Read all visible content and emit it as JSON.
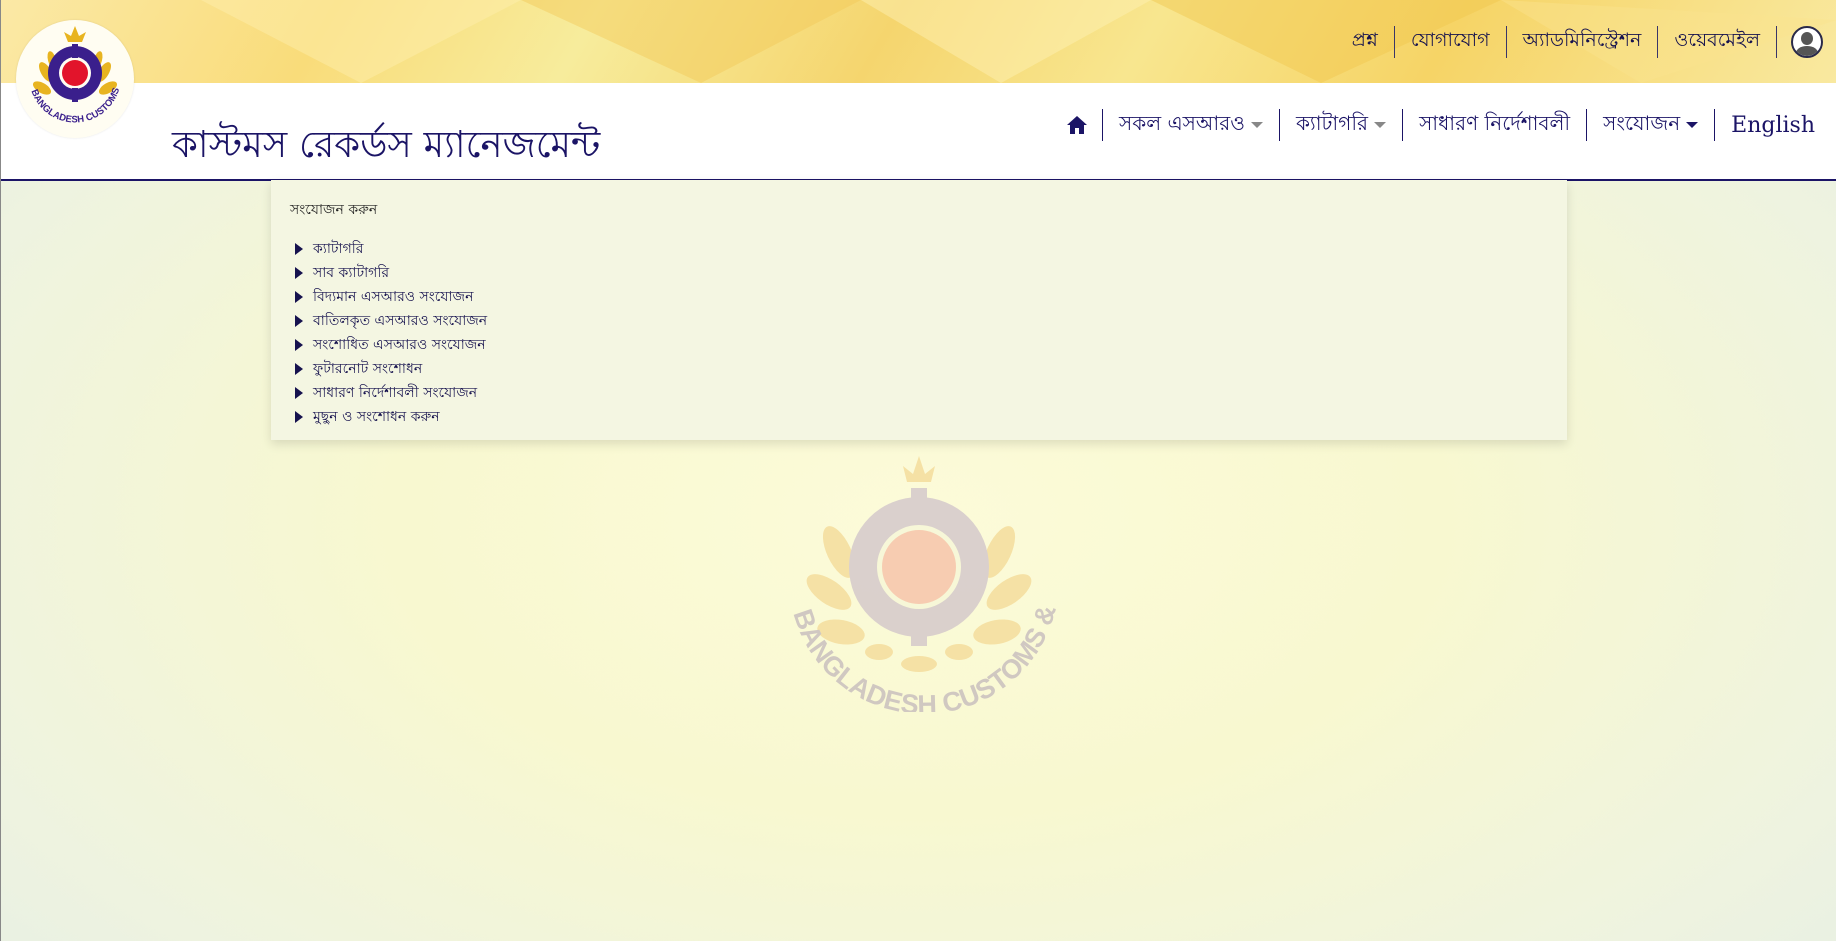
{
  "top_links": [
    "প্রশ্ন",
    "যোগাযোগ",
    "অ্যাডমিনিস্ট্রেশন",
    "ওয়েবমেইল"
  ],
  "site": {
    "title": "কাস্টমস রেকর্ডস ম্যানেজমেন্ট",
    "logo_text": "BANGLADESH CUSTOMS & VAT"
  },
  "nav": {
    "all_sro": "সকল এসআরও",
    "category": "ক্যাটাগরি",
    "general_instructions": "সাধারণ নির্দেশাবলী",
    "add": "সংযোজন",
    "language": "English"
  },
  "dropdown": {
    "header": "সংযোজন করুন",
    "items": [
      "ক্যাটাগরি",
      "সাব ক্যাটাগরি",
      "বিদ্যমান এসআরও সংযোজন",
      "বাতিলকৃত এসআরও সংযোজন",
      "সংশোধিত এসআরও সংযোজন",
      "ফুটারনোট সংশোধন",
      "সাধারণ নির্দেশাবলী সংযোজন",
      "মুছুন ও সংশোধন করুন"
    ]
  },
  "watermark": {
    "text": "BANGLADESH CUSTOMS & VAT"
  },
  "colors": {
    "brand": "#1b1466",
    "logo_red": "#e2142b",
    "logo_gold": "#e8b420"
  }
}
